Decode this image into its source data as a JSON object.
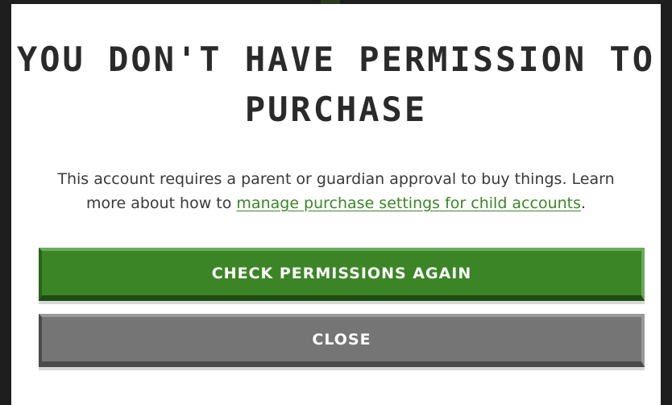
{
  "dialog": {
    "title": "YOU DON'T HAVE PERMISSION TO PURCHASE",
    "message_before_link": "This account requires a parent or guardian approval to buy things. Learn more about how to ",
    "link_text": "manage purchase settings for child accounts",
    "message_after_link": "."
  },
  "buttons": {
    "primary_label": "CHECK PERMISSIONS AGAIN",
    "secondary_label": "CLOSE"
  },
  "colors": {
    "accent_green": "#3c8527",
    "button_gray": "#757575",
    "title_text": "#2a2a2a",
    "body_text": "#3a3a3a"
  }
}
